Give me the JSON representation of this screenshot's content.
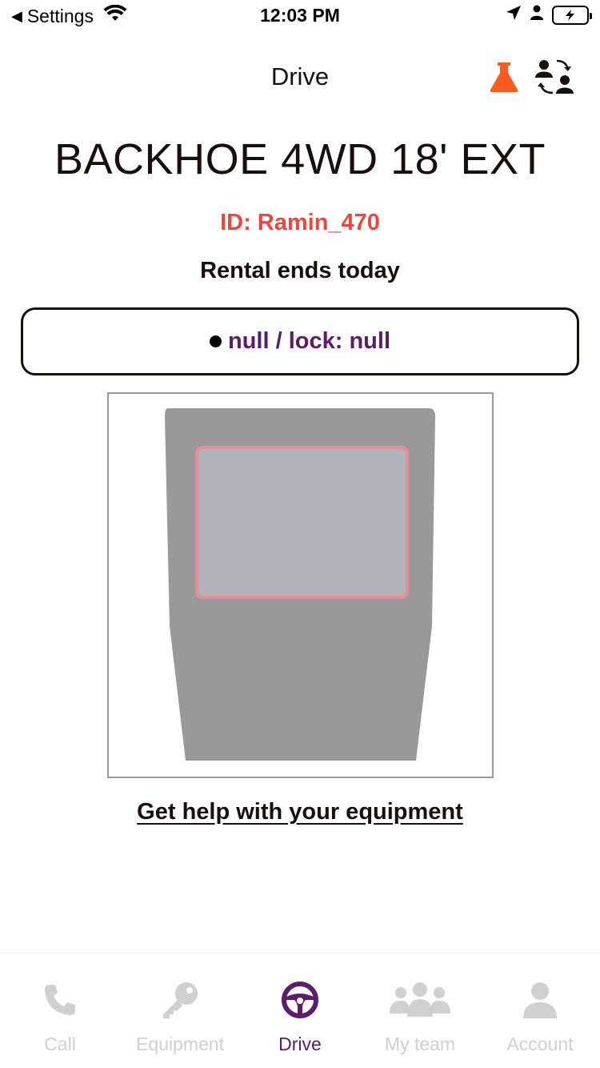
{
  "status_bar": {
    "back_label": "Settings",
    "time": "12:03 PM"
  },
  "header": {
    "title": "Drive",
    "flask_icon": "flask-icon",
    "switch_team_icon": "team-swap-icon"
  },
  "equipment": {
    "name": "BACKHOE 4WD 18' EXT",
    "id_text": "ID: Ramin_470",
    "rental_status": "Rental ends today",
    "lock_status": "null / lock: null",
    "image": "equipment-silhouette"
  },
  "help_link": "Get help with your equipment",
  "tabs": [
    {
      "label": "Call",
      "icon": "phone-icon",
      "active": false
    },
    {
      "label": "Equipment",
      "icon": "key-icon",
      "active": false
    },
    {
      "label": "Drive",
      "icon": "steering-wheel-icon",
      "active": true
    },
    {
      "label": "My team",
      "icon": "group-icon",
      "active": false
    },
    {
      "label": "Account",
      "icon": "person-icon",
      "active": false
    }
  ],
  "colors": {
    "accent": "#5c1c6b",
    "id_red": "#e8483f",
    "flask_orange": "#ff5a1f",
    "inactive_tab": "#d0d0d0",
    "battery_green": "#3ac245"
  }
}
